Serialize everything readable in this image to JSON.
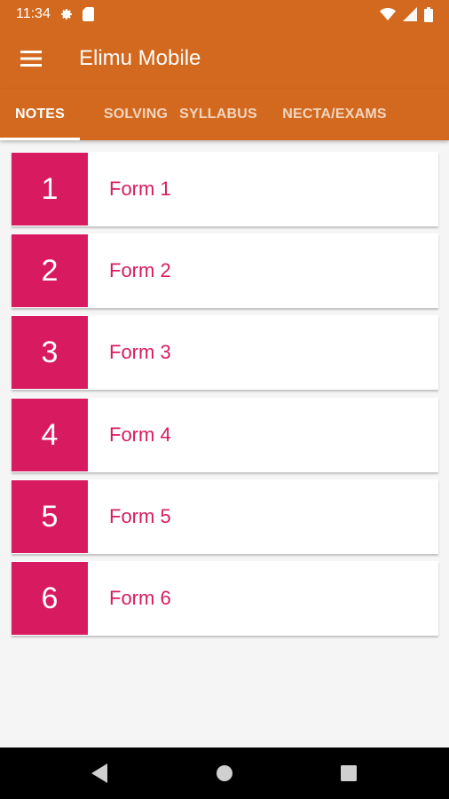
{
  "status": {
    "time": "11:34",
    "icons_left": [
      "gear-icon",
      "sd-card-icon"
    ],
    "icons_right": [
      "wifi-icon",
      "cell-signal-icon",
      "battery-icon"
    ]
  },
  "app_bar": {
    "title": "Elimu Mobile",
    "menu_icon": "hamburger-menu-icon"
  },
  "tabs": [
    {
      "label": "NOTES",
      "active": true
    },
    {
      "label": "SOLVING",
      "active": false
    },
    {
      "label": "SYLLABUS",
      "active": false
    },
    {
      "label": "NECTA/EXAMS",
      "active": false
    }
  ],
  "forms": [
    {
      "number": "1",
      "label": "Form 1"
    },
    {
      "number": "2",
      "label": "Form 2"
    },
    {
      "number": "3",
      "label": "Form 3"
    },
    {
      "number": "4",
      "label": "Form 4"
    },
    {
      "number": "5",
      "label": "Form 5"
    },
    {
      "number": "6",
      "label": "Form 6"
    }
  ],
  "nav": [
    "back-icon",
    "home-icon",
    "recents-icon"
  ],
  "colors": {
    "primary": "#d2691e",
    "accent": "#d81b60",
    "background": "#f5f5f5"
  }
}
